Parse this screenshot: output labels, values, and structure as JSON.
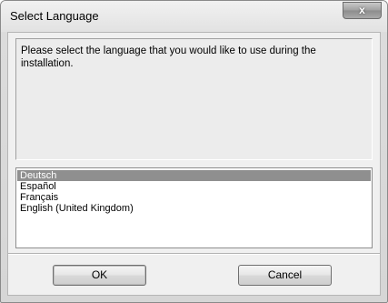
{
  "window": {
    "title": "Select Language",
    "close_label": "x"
  },
  "message": "Please select the language that you would like to use during the installation.",
  "languages": {
    "selected_index": 0,
    "items": [
      "Deutsch",
      "Español",
      "Français",
      "English (United Kingdom)"
    ]
  },
  "buttons": {
    "ok_label": "OK",
    "cancel_label": "Cancel"
  },
  "colors": {
    "selection_background": "#8f8f8f",
    "selection_text": "#ffffff"
  }
}
